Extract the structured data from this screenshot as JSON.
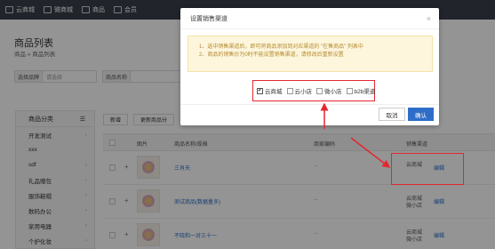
{
  "topnav": {
    "items": [
      {
        "label": "云商城",
        "icon": "cloud-icon"
      },
      {
        "label": "微商城",
        "icon": "shop-icon"
      },
      {
        "label": "商品",
        "icon": "goods-icon"
      },
      {
        "label": "会员",
        "icon": "member-icon"
      }
    ]
  },
  "page": {
    "title": "商品列表",
    "breadcrumb": "商品 » 商品列表"
  },
  "filters": [
    {
      "label": "选择品牌",
      "placeholder": "请选择"
    },
    {
      "label": "商品名称",
      "placeholder": ""
    }
  ],
  "sidebar": {
    "header": "商品分类",
    "categories": [
      "开发测试",
      "xxx",
      "sdf",
      "礼品赠包",
      "服饰鞋帽",
      "数码办公",
      "家用电器",
      "个护化妆"
    ]
  },
  "toolbar": {
    "new_label": "新增",
    "update_label": "更新商品分"
  },
  "table": {
    "headers": {
      "image": "图片",
      "name": "商品名称/规格",
      "code": "商家编码",
      "channel": "销售渠道"
    },
    "rows": [
      {
        "name": "三肖天",
        "code": "--",
        "channels": "云商城",
        "edit": "编辑"
      },
      {
        "name": "测试商品(数据量多)",
        "code": "--",
        "channels": "云商城 微小店",
        "edit": "编辑"
      },
      {
        "name": "不晓和一对三十一",
        "code": "--",
        "channels": "云商城 微小店",
        "edit": "编辑"
      }
    ]
  },
  "modal": {
    "title": "设置销售渠道",
    "close": "×",
    "tips": [
      "1、选中销售渠道后，即可将商品添加到对应渠道的 \"在售商品\" 列表中",
      "2、商品的销售价为0时不能设置销售渠道，请修改后重新设置"
    ],
    "options": [
      {
        "label": "云商城",
        "checked": true
      },
      {
        "label": "云小店",
        "checked": false
      },
      {
        "label": "微小店",
        "checked": false
      },
      {
        "label": "b2b渠道",
        "checked": false
      }
    ],
    "cancel_label": "取消",
    "ok_label": "确认"
  },
  "colors": {
    "accent": "#2f6ec8",
    "highlight": "#e5272f",
    "nav": "#3a3f4a"
  }
}
